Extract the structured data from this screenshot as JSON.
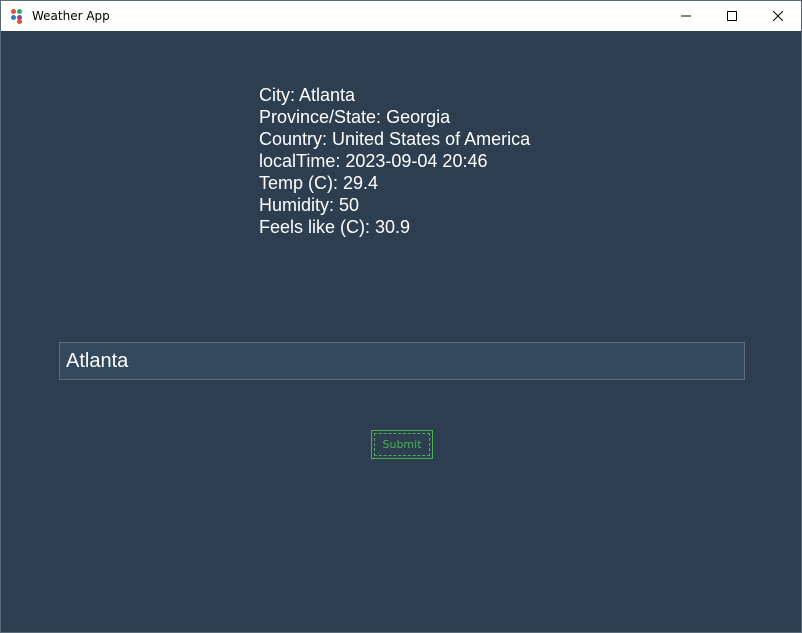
{
  "window": {
    "title": "Weather App",
    "controls": [
      "minimize-icon",
      "maximize-icon",
      "close-icon"
    ]
  },
  "weather": {
    "city": "City: Atlanta",
    "province": "Province/State: Georgia",
    "country": "Country: United States of America",
    "local_time": "localTime: 2023-09-04 20:46",
    "temp": "Temp (C): 29.4",
    "humidity": "Humidity: 50",
    "feels_like": "Feels like (C): 30.9"
  },
  "search": {
    "value": "Atlanta"
  },
  "submit": {
    "label": "Submit"
  },
  "colors": {
    "background": "#2c3e50",
    "input_bg": "#34495e",
    "accent": "#4caf50",
    "text": "#ffffff"
  }
}
